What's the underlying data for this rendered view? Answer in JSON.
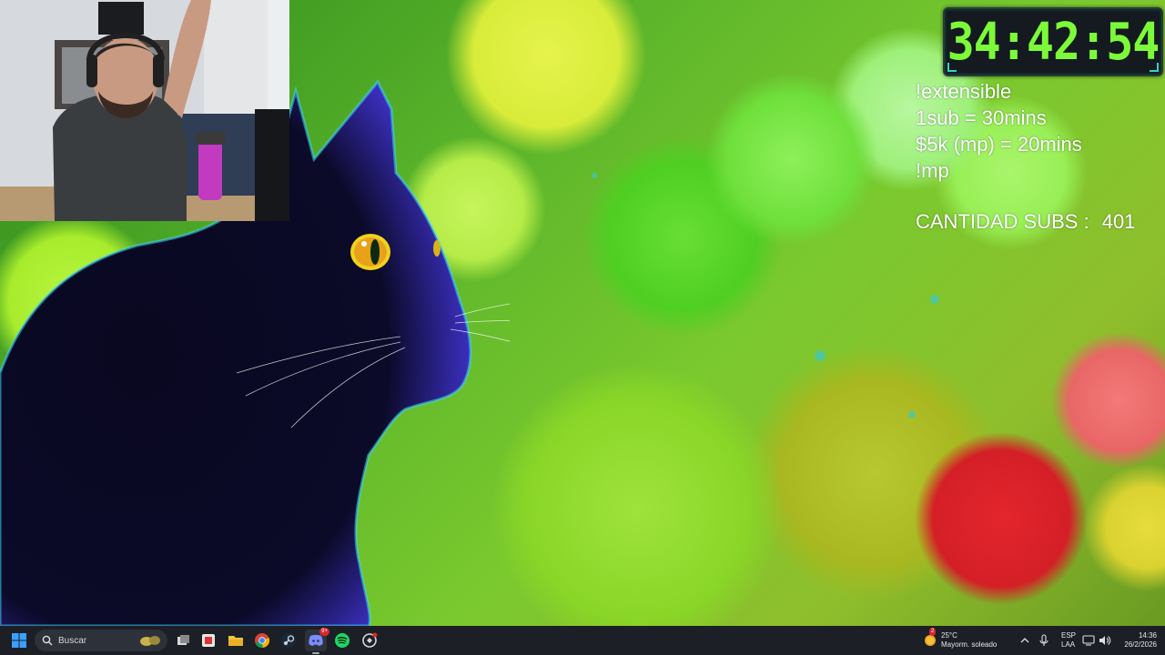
{
  "overlay": {
    "timer": "34:42:54",
    "lines": [
      "!extensible",
      "1sub = 30mins",
      "$5k (mp) = 20mins",
      "!mp"
    ],
    "subs_label": "CANTIDAD SUBS :",
    "subs_count": "401"
  },
  "taskbar": {
    "search_placeholder": "Buscar",
    "discord_badge": "9+",
    "weather_temp": "25°C",
    "weather_desc": "Mayorm. soleado",
    "weather_badge": "2",
    "language_line1": "ESP",
    "language_line2": "LAA",
    "time": "14:36",
    "date": "26/2/2026"
  },
  "icons": [
    "start-icon",
    "search-icon",
    "task-view-icon",
    "file-explorer-icon",
    "chrome-icon",
    "steam-icon",
    "discord-icon",
    "spotify-icon",
    "app-icon",
    "weather-icon",
    "chevron-up-icon",
    "microphone-icon",
    "network-icon",
    "volume-icon"
  ]
}
